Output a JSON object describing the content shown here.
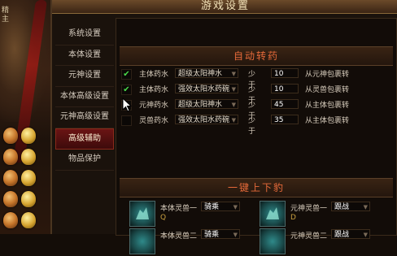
{
  "window": {
    "title": "游戏设置"
  },
  "left_hud": {
    "corner_text": "精\n主"
  },
  "nav": {
    "items": [
      {
        "label": "系统设置"
      },
      {
        "label": "本体设置"
      },
      {
        "label": "元神设置"
      },
      {
        "label": "本体高级设置"
      },
      {
        "label": "元神高级设置"
      },
      {
        "label": "高级辅助",
        "active": true
      },
      {
        "label": "物品保护"
      }
    ]
  },
  "auto_drug": {
    "title": "自动转药",
    "lt_label": "少于",
    "rows": [
      {
        "checked": true,
        "label": "主体药水",
        "item": "超级太阳神水",
        "value": "10",
        "from": "从元神包裹转"
      },
      {
        "checked": true,
        "label": "主体药水",
        "item": "强效太阳水药碗",
        "value": "10",
        "from": "从灵兽包裹转"
      },
      {
        "checked": false,
        "label": "元神药水",
        "item": "超级太阳神水",
        "value": "45",
        "from": "从主体包裹转"
      },
      {
        "checked": false,
        "label": "灵兽药水",
        "item": "强效太阳水药碗",
        "value": "35",
        "from": "从主体包裹转"
      }
    ]
  },
  "mount": {
    "title": "一键上下豹",
    "rows": [
      {
        "left_label": "本体灵兽一",
        "left_value": "骑乘",
        "left_key": "Q",
        "right_label": "元神灵兽一",
        "right_value": "跟战",
        "right_key": "D"
      },
      {
        "left_label": "本体灵兽二",
        "left_value": "骑乘",
        "right_label": "元神灵兽二",
        "right_value": "跟战"
      }
    ]
  },
  "colors": {
    "accent": "#e66a3a",
    "check": "#4ad84a",
    "active_tab": "#6a1414"
  }
}
